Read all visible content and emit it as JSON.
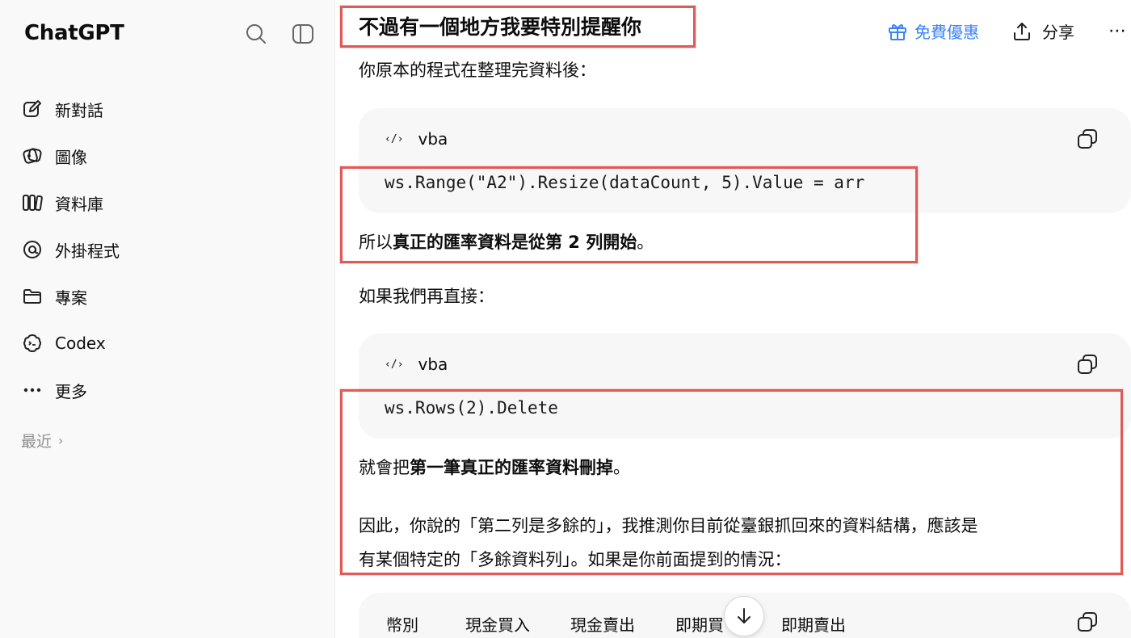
{
  "sidebar": {
    "brand": "ChatGPT",
    "items": [
      {
        "label": "新對話",
        "icon": "edit-icon"
      },
      {
        "label": "圖像",
        "icon": "image-icon"
      },
      {
        "label": "資料庫",
        "icon": "library-icon"
      },
      {
        "label": "外掛程式",
        "icon": "plugin-icon"
      },
      {
        "label": "專案",
        "icon": "folder-icon"
      },
      {
        "label": "Codex",
        "icon": "codex-icon"
      },
      {
        "label": "更多",
        "icon": "more-icon"
      }
    ],
    "recent_label": "最近"
  },
  "header": {
    "offer_label": "免費優惠",
    "share_label": "分享",
    "more_label": "⋯"
  },
  "content": {
    "heading": "不過有一個地方我要特別提醒你",
    "intro": "你原本的程式在整理完資料後：",
    "code1": {
      "lang": "vba",
      "code": "ws.Range(\"A2\").Resize(dataCount, 5).Value = arr"
    },
    "para2_prefix": "所以",
    "para2_bold": "真正的匯率資料是從第 2 列開始",
    "para2_suffix": "。",
    "para3": "如果我們再直接：",
    "code2": {
      "lang": "vba",
      "code": "ws.Rows(2).Delete"
    },
    "para4_prefix": "就會把",
    "para4_bold": "第一筆真正的匯率資料刪掉",
    "para4_suffix": "。",
    "para5_line1": "因此，你說的「第二列是多餘的」，我推測你目前從臺銀抓回來的資料結構，應該是",
    "para5_line2": "有某個特定的「多餘資料列」。如果是你前面提到的情況：",
    "table_headers": [
      "幣別",
      "現金買入",
      "現金賣出",
      "即期買",
      "即期賣出"
    ]
  },
  "colors": {
    "accent": "#3b82f6",
    "highlight": "#e05a56",
    "code_bg": "#f7f7f8"
  }
}
